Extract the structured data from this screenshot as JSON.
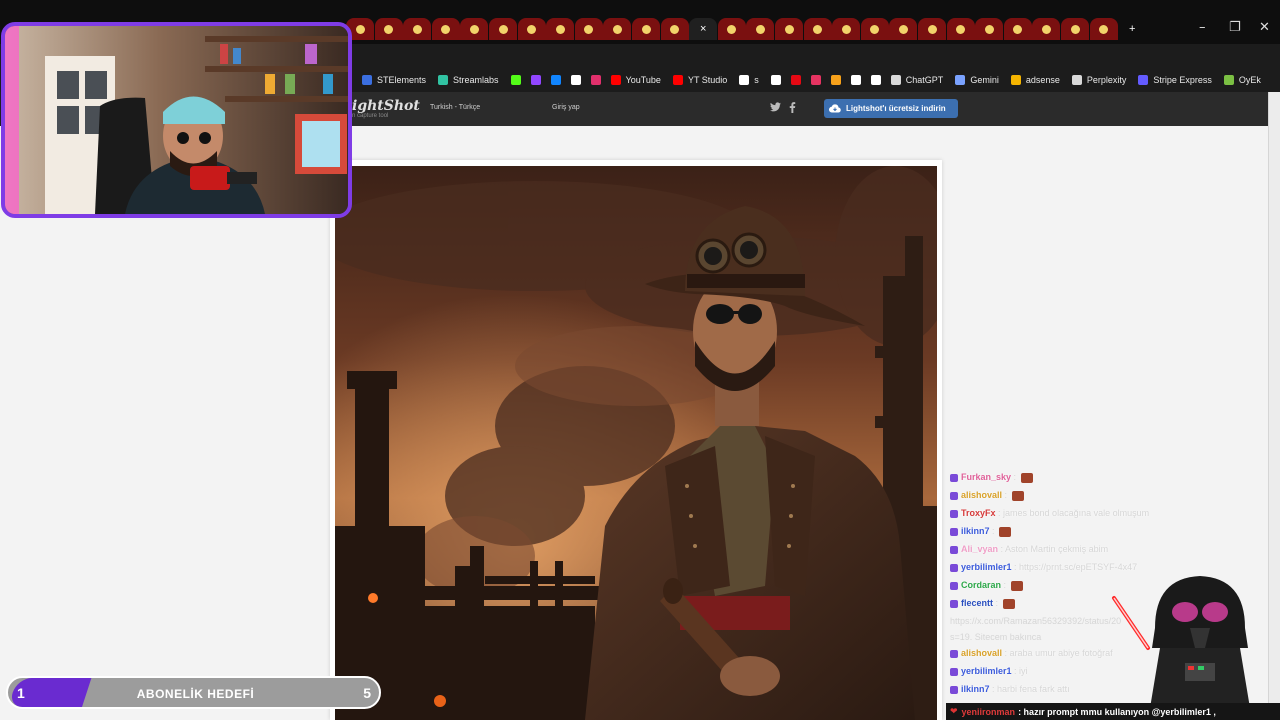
{
  "tabs": [
    "",
    "",
    "",
    "",
    "",
    "",
    "",
    "",
    "",
    "",
    "",
    "",
    "",
    "",
    "",
    "",
    "",
    "",
    "",
    "",
    "",
    "",
    "",
    "",
    "",
    "",
    ""
  ],
  "active_tab_close": "×",
  "new_tab": "+",
  "window_controls": {
    "minimize": "–",
    "maximize": "❐",
    "close": "✕"
  },
  "bookmarks": [
    {
      "label": "STElements",
      "color": "#3b6fe0"
    },
    {
      "label": "Streamlabs",
      "color": "#31c3a2"
    },
    {
      "label": "",
      "color": "#53fc18"
    },
    {
      "label": "",
      "color": "#9146ff"
    },
    {
      "label": "",
      "color": "#1185fe"
    },
    {
      "label": "",
      "color": "#ffffff"
    },
    {
      "label": "",
      "color": "#e1306c"
    },
    {
      "label": "YouTube",
      "color": "#ff0000"
    },
    {
      "label": "YT Studio",
      "color": "#ff0000"
    },
    {
      "label": "s",
      "color": "#ffffff"
    },
    {
      "label": "",
      "color": "#ffffff"
    },
    {
      "label": "",
      "color": "#e50914"
    },
    {
      "label": "",
      "color": "#e63462"
    },
    {
      "label": "",
      "color": "#f7a21b"
    },
    {
      "label": "",
      "color": "#ffffff"
    },
    {
      "label": "",
      "color": "#ffffff"
    },
    {
      "label": "ChatGPT",
      "color": "#d9d9d9"
    },
    {
      "label": "Gemini",
      "color": "#7aa2ff"
    },
    {
      "label": "adsense",
      "color": "#f4b400"
    },
    {
      "label": "Perplexity",
      "color": "#d9d9d9"
    },
    {
      "label": "Stripe Express",
      "color": "#635bff"
    },
    {
      "label": "OyEk",
      "color": "#7bc043"
    }
  ],
  "lightshot": {
    "logo": "ightShot",
    "tagline": "n capture tool",
    "language": "Turkish - Türkçe",
    "login": "Giriş yap",
    "download": "Lightshot'ı ücretsiz indirin"
  },
  "chat": {
    "lines": [
      {
        "user": "Furkan_sky",
        "msg": "",
        "color": "#e0629a"
      },
      {
        "user": "alishovall",
        "msg": "",
        "color": "#d9a22a"
      },
      {
        "user": "TroxyFx",
        "msg": "james bond olacağına vale olmuşum",
        "color": "#d63a3a"
      },
      {
        "user": "ilkinn7",
        "msg": "",
        "color": "#3b5bdb"
      },
      {
        "user": "Ali_vyan",
        "msg": "Aston Martin çekmiş abim",
        "color": "#f0a0c8"
      },
      {
        "user": "yerbilimler1",
        "msg": "https://prnt.sc/epETSYF-4x47",
        "color": "#3b5bdb"
      },
      {
        "user": "Cordaran",
        "msg": "",
        "color": "#2ea84a"
      },
      {
        "user": "flecentt",
        "msg": "",
        "color": "#2a4fbf"
      },
      {
        "user": "alishovall",
        "msg": "araba umur abiye fotoğraf",
        "color": "#d9a22a"
      },
      {
        "user": "yerbilimler1",
        "msg": "iyi",
        "color": "#3b5bdb"
      },
      {
        "user": "ilkinn7",
        "msg": "harbi fena fark attı",
        "color": "#3b5bdb"
      }
    ],
    "wrap1": "https://x.com/Ramazan56329392/status/20",
    "wrap1b": "1182",
    "wrap2": "s=19. Sitecem bakınca"
  },
  "sub_goal": {
    "current": "1",
    "label": "ABONELİK HEDEFİ",
    "target": "5",
    "progress": 0.2
  },
  "ticker": {
    "user": "yeniironman",
    "msg": ": hazır prompt mmu kullanıyon @yerbilimler1 ,"
  }
}
